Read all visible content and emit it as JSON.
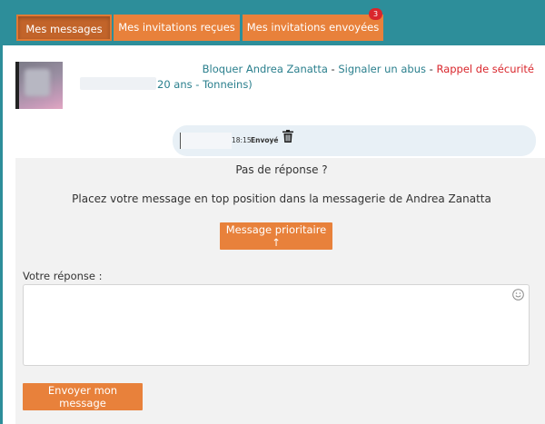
{
  "tabs": [
    {
      "label": "Mes messages",
      "active": true
    },
    {
      "label": "Mes invitations reçues",
      "active": false
    },
    {
      "label": "Mes invitations envoyées",
      "active": false,
      "badge": "3"
    }
  ],
  "profile": {
    "meta": "20 ans - Tonneins)"
  },
  "actions": {
    "block": "Bloquer Andrea Zanatta",
    "sep1": " - ",
    "report": "Signaler un abus",
    "sep2": " - ",
    "safety": "Rappel de sécurité"
  },
  "message": {
    "time": "18:15",
    "status": "Envoyé"
  },
  "panel": {
    "no_reply": "Pas de réponse ?",
    "promo": "Placez votre message en top position dans la messagerie de Andrea Zanatta",
    "priority_button": "Message prioritaire ↑",
    "reply_label": "Votre réponse :",
    "reply_value": "",
    "send_button": "Envoyer mon message"
  },
  "colors": {
    "teal": "#2d8e9a",
    "orange": "#e8813b",
    "red": "#d9262c"
  },
  "icons": [
    "trash-icon",
    "emoji-icon"
  ]
}
